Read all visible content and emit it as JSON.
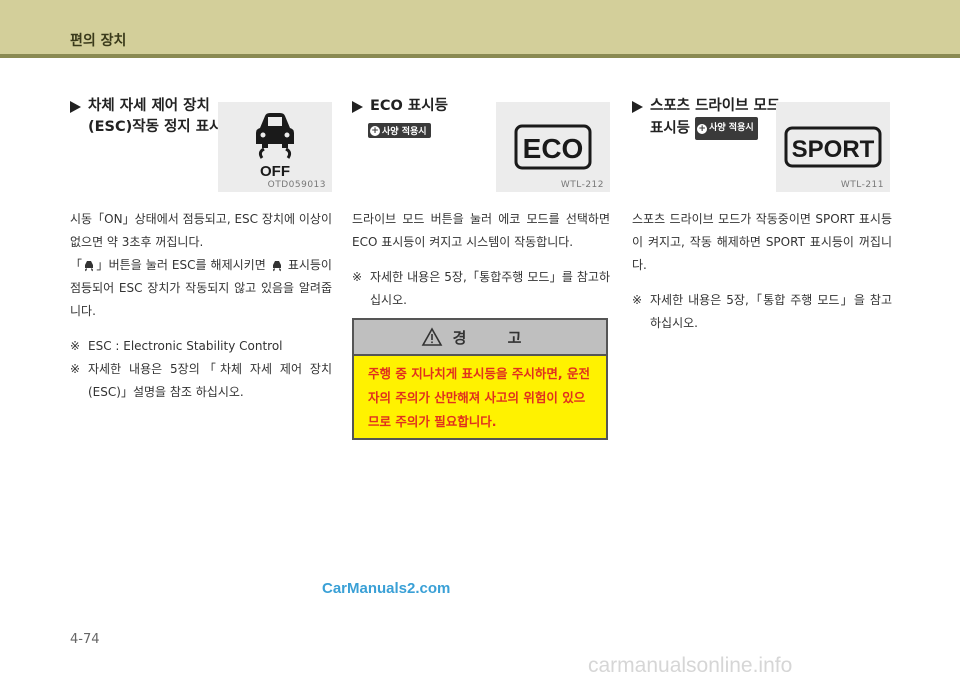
{
  "header": {
    "title": "편의 장치"
  },
  "section1": {
    "title_line1": "차체 자세 제어 장치",
    "title_line2": "(ESC)작동 정지 표시등",
    "icon_label": "OFF",
    "icon_code": "OTD059013",
    "para1": "시동「ON」상태에서 점등되고, ESC 장치에 이상이 없으면 약 3초후 꺼집니다.",
    "para2_a": "「",
    "para2_b": "」버튼을 눌러 ESC를 해제시키면",
    "para2_c": "표시등이 점등되어 ESC 장치가 작동되지 않고 있음을 알려줍니다.",
    "note_mark": "※",
    "note1": "ESC : Electronic Stability Control",
    "note2": "자세한 내용은 5장의「차체 자세 제어 장치(ESC)」설명을 참조 하십시오."
  },
  "section2": {
    "title": "ECO 표시등",
    "badge": "사양 적용시",
    "icon_label": "ECO",
    "icon_code": "WTL-212",
    "para1": "드라이브 모드 버튼을 눌러 에코 모드를 선택하면 ECO 표시등이 켜지고 시스템이 작동합니다.",
    "note_mark": "※",
    "note1": "자세한 내용은 5장,「통합주행 모드」를 참고하십시오."
  },
  "warning": {
    "title": "경 고",
    "body": "주행 중 지나치게 표시등을 주시하면, 운전자의 주의가 산만해져 사고의 위험이 있으므로 주의가 필요합니다."
  },
  "section3": {
    "title_line1": "스포츠 드라이브 모드",
    "title_line2": "표시등",
    "badge": "사양 적용시",
    "icon_label": "SPORT",
    "icon_code": "WTL-211",
    "para1": "스포츠 드라이브 모드가 작동중이면 SPORT 표시등이 켜지고, 작동 해제하면 SPORT 표시등이 꺼집니다.",
    "note_mark": "※",
    "note1": "자세한 내용은 5장,「통합 주행 모드」을 참고하십시오."
  },
  "watermark": "CarManuals2.com",
  "page_number": "4-74",
  "footer_watermark": "carmanualsonline.info",
  "colors": {
    "header": "#d3cf9a",
    "warning_bg": "#fff200",
    "warning_text": "#e0301e"
  }
}
